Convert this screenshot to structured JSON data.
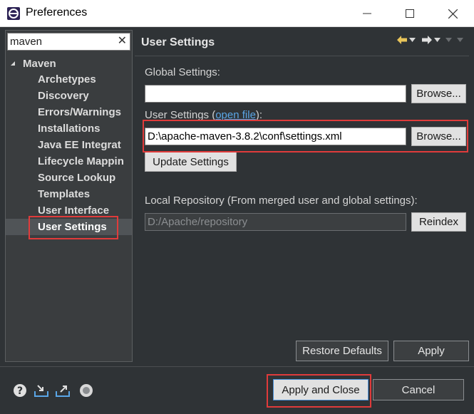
{
  "window": {
    "title": "Preferences"
  },
  "filter": {
    "value": "maven"
  },
  "tree": {
    "root": "Maven",
    "items": [
      "Archetypes",
      "Discovery",
      "Errors/Warnings",
      "Installations",
      "Java EE Integrat",
      "Lifecycle Mappin",
      "Source Lookup",
      "Templates",
      "User Interface",
      "User Settings"
    ],
    "selected": "User Settings"
  },
  "page": {
    "title": "User Settings",
    "global_settings_label": "Global Settings:",
    "global_settings_value": "",
    "user_settings_label_prefix": "User Settings (",
    "user_settings_link": "open file",
    "user_settings_label_suffix": "):",
    "user_settings_value": "D:\\apache-maven-3.8.2\\conf\\settings.xml",
    "browse_label": "Browse...",
    "update_settings_label": "Update Settings",
    "local_repo_label": "Local Repository (From merged user and global settings):",
    "local_repo_value": "D:/Apache/repository",
    "reindex_label": "Reindex",
    "restore_defaults_label": "Restore Defaults",
    "apply_label": "Apply"
  },
  "footer": {
    "apply_close_label": "Apply and Close",
    "cancel_label": "Cancel"
  },
  "colors": {
    "highlight": "#e03b3b",
    "link": "#5aa6e6"
  }
}
